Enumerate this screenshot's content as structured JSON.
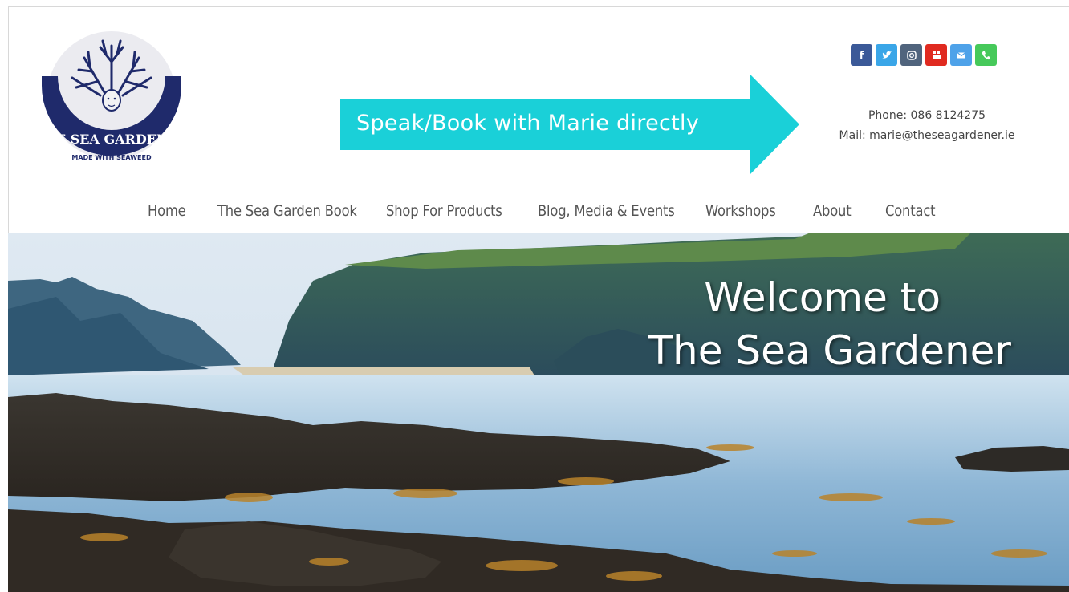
{
  "brand": {
    "logo_text_top": "THE SEA GARDENER",
    "logo_text_bottom": "MADE WITH SEAWEED",
    "logo_colors": {
      "navy": "#1f2a6b",
      "circle": "#e9e9ee"
    }
  },
  "callout": {
    "text": "Speak/Book with Marie directly",
    "color": "#1ad0d8"
  },
  "social": [
    {
      "name": "facebook-icon",
      "glyph": "f",
      "color": "#3b5998"
    },
    {
      "name": "twitter-icon",
      "glyph": "t",
      "color": "#3aa6e8"
    },
    {
      "name": "instagram-icon",
      "glyph": "i",
      "color": "#50647d"
    },
    {
      "name": "youtube-icon",
      "glyph": "yt",
      "color": "#e02a20"
    },
    {
      "name": "mail-icon",
      "glyph": "m",
      "color": "#4ea2e9"
    },
    {
      "name": "phone-icon",
      "glyph": "p",
      "color": "#46c95a"
    }
  ],
  "contact": {
    "phone": "Phone: 086 8124275",
    "mail": "Mail: marie@theseagardener.ie"
  },
  "nav": {
    "items": [
      {
        "label": "Home"
      },
      {
        "label": "The Sea Garden Book"
      },
      {
        "label": "Shop For Products"
      },
      {
        "label": "Blog, Media & Events"
      },
      {
        "label": "Workshops"
      },
      {
        "label": "About"
      },
      {
        "label": "Contact"
      }
    ]
  },
  "hero": {
    "title_line1": "Welcome to",
    "title_line2": "The Sea Gardener"
  }
}
